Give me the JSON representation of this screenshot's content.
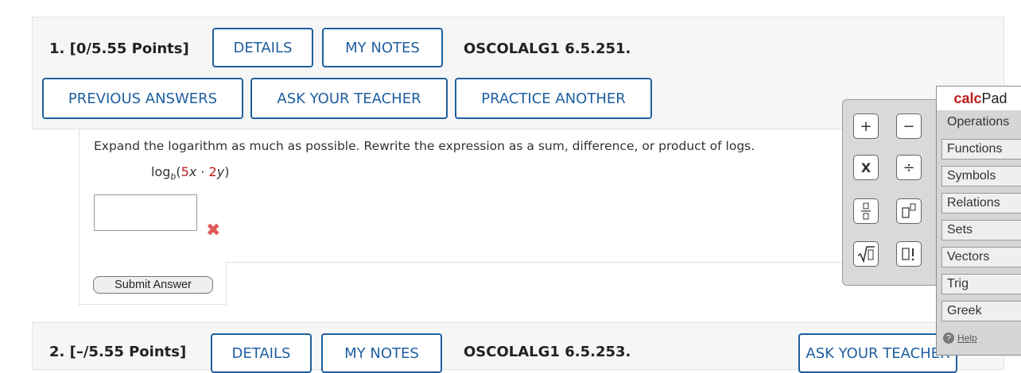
{
  "question1": {
    "number_label": "1.  [0/5.55 Points]",
    "details_label": "DETAILS",
    "my_notes_label": "MY NOTES",
    "code": "OSCOLALG1 6.5.251.",
    "previous_answers_label": "PREVIOUS ANSWERS",
    "ask_teacher_label": "ASK YOUR TEACHER",
    "practice_another_label": "PRACTICE ANOTHER",
    "prompt": "Expand the logarithm as much as possible. Rewrite the expression as a sum, difference, or product of logs.",
    "expression": {
      "log": "log",
      "base": "b",
      "open": "(",
      "coef1": "5",
      "var1": "x",
      "dot": " · ",
      "coef2": "2",
      "var2": "y",
      "close": ")"
    },
    "answer_value": "",
    "incorrect_mark": "✖",
    "submit_label": "Submit Answer"
  },
  "question2": {
    "number_label": "2.  [–/5.55 Points]",
    "details_label": "DETAILS",
    "my_notes_label": "MY NOTES",
    "code": "OSCOLALG1 6.5.253.",
    "ask_teacher_label": "ASK YOUR TEACHER"
  },
  "calcpad": {
    "title_calc": "calc",
    "title_pad": "Pad",
    "categories": [
      "Operations",
      "Functions",
      "Symbols",
      "Relations",
      "Sets",
      "Vectors",
      "Trig",
      "Greek"
    ],
    "active_category": "Operations",
    "help_label": "Help",
    "help_icon": "question-icon",
    "operations": [
      {
        "name": "plus",
        "glyph": "+"
      },
      {
        "name": "minus",
        "glyph": "−"
      },
      {
        "name": "times",
        "glyph": "X"
      },
      {
        "name": "divide",
        "glyph": "÷"
      },
      {
        "name": "fraction",
        "glyph": "▯/▯"
      },
      {
        "name": "power",
        "glyph": "▯▯"
      },
      {
        "name": "sqrt",
        "glyph": "√▯"
      },
      {
        "name": "factorial",
        "glyph": "▯!"
      }
    ]
  },
  "colors": {
    "accent_blue": "#1f5fa0",
    "incorrect_red": "#e05858",
    "highlight_red": "#c01a1a"
  }
}
